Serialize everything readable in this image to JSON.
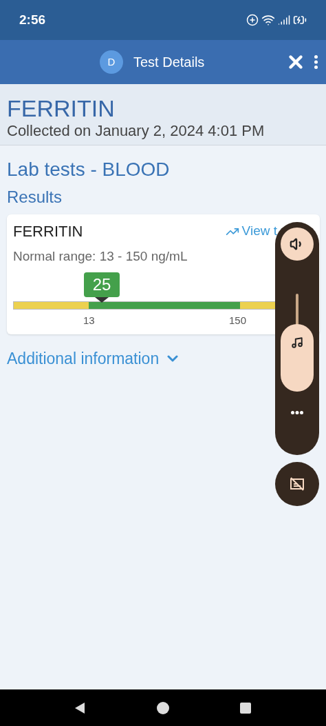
{
  "status_bar": {
    "time": "2:56"
  },
  "app_bar": {
    "avatar": "D",
    "title": "Test Details"
  },
  "header": {
    "title": "FERRITIN",
    "subtitle": "Collected on January 2, 2024 4:01 PM"
  },
  "section": {
    "title": "Lab tests - BLOOD",
    "subtitle": "Results"
  },
  "result_card": {
    "name": "FERRITIN",
    "link": "View t",
    "range": "Normal range: 13 - 150 ng/mL",
    "value": "25",
    "low_label": "13",
    "high_label": "150"
  },
  "additional_info": {
    "label": "Additional information",
    "expanded": false
  },
  "volume_panel": {
    "level": 0.45
  }
}
